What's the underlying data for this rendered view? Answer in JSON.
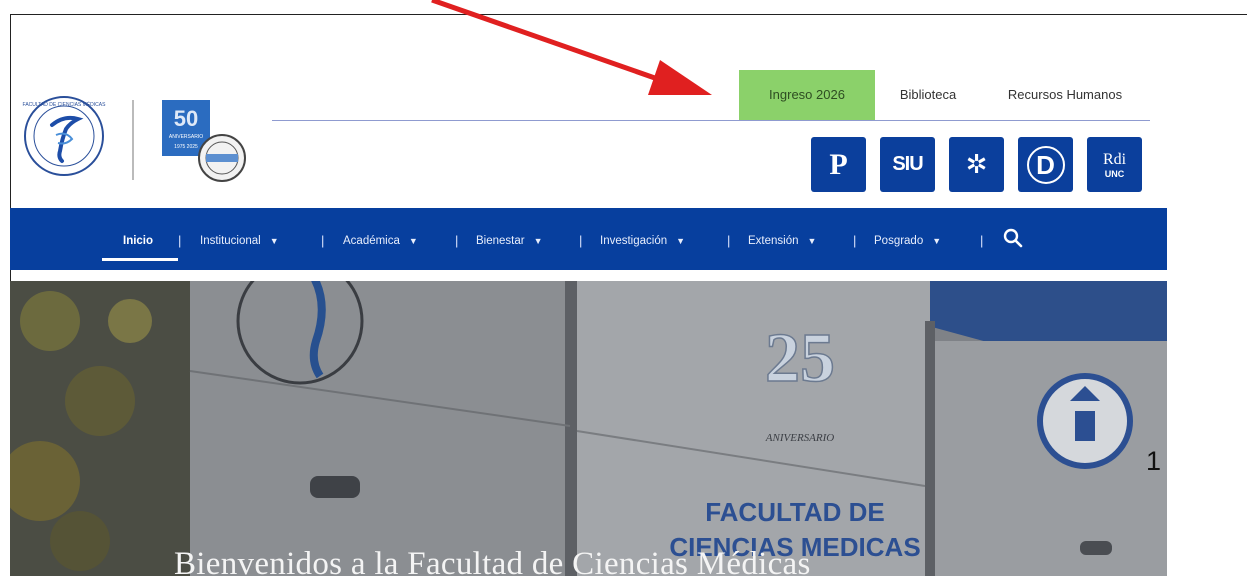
{
  "top_links": {
    "ingreso": "Ingreso 2026",
    "biblioteca": "Biblioteca",
    "recursos_humanos": "Recursos Humanos"
  },
  "quick_icons": [
    {
      "name": "campus-virtual-icon",
      "glyph": "P"
    },
    {
      "name": "siu-icon",
      "glyph": "SIU"
    },
    {
      "name": "globe-icon",
      "glyph": "✲"
    },
    {
      "name": "digital-icon",
      "glyph": "D"
    },
    {
      "name": "rdi-unc-icon",
      "glyph": "Rdi",
      "sub": "UNC"
    }
  ],
  "nav": {
    "items": [
      {
        "label": "Inicio"
      },
      {
        "label": "Institucional"
      },
      {
        "label": "Académica"
      },
      {
        "label": "Bienestar"
      },
      {
        "label": "Investigación"
      },
      {
        "label": "Extensión"
      },
      {
        "label": "Posgrado"
      }
    ],
    "separator": "|"
  },
  "hero": {
    "title": "Bienvenidos a la Facultad de Ciencias Médicas",
    "sign_line1": "FACULTAD DE",
    "sign_line2": "CIENCIAS MEDICAS",
    "anniversary_number": "25",
    "anniversary_word": "ANIVERSARIO"
  },
  "logos": {
    "fifty_number": "50",
    "fifty_caption": "ANIVERSARIO",
    "fifty_years": "1975 2025"
  },
  "annotation": {
    "page_number": "1",
    "arrow_color": "#e02020"
  },
  "colors": {
    "nav_blue": "#073f9e",
    "icon_blue": "#0b3f9c",
    "ingreso_green": "#8bd16a"
  }
}
